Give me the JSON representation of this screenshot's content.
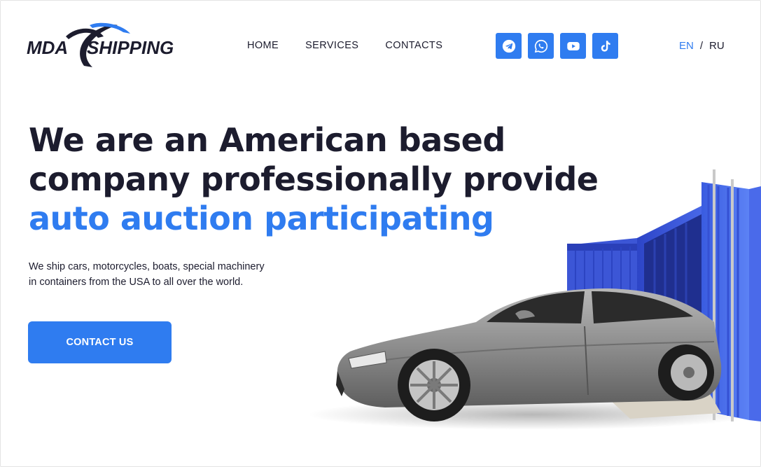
{
  "logo": {
    "left_text": "MDA",
    "right_text": "SHIPPING"
  },
  "nav": {
    "items": [
      "HOME",
      "SERVICES",
      "CONTACTS"
    ]
  },
  "social": [
    {
      "icon": "telegram-icon"
    },
    {
      "icon": "whatsapp-icon"
    },
    {
      "icon": "youtube-icon"
    },
    {
      "icon": "tiktok-icon"
    }
  ],
  "lang": {
    "en": "EN",
    "separator": "/",
    "ru": "RU",
    "active": "EN"
  },
  "hero": {
    "line1": "We are an American based",
    "line2": "company professionally provide",
    "accent": "auto auction participating",
    "desc_line1": "We ship cars, motorcycles, boats, special machinery",
    "desc_line2": "in containers from the USA to all over the world.",
    "cta": "CONTACT US"
  },
  "colors": {
    "accent": "#2f7cf0",
    "text": "#1c1c2e",
    "container": "#3a55d8"
  }
}
